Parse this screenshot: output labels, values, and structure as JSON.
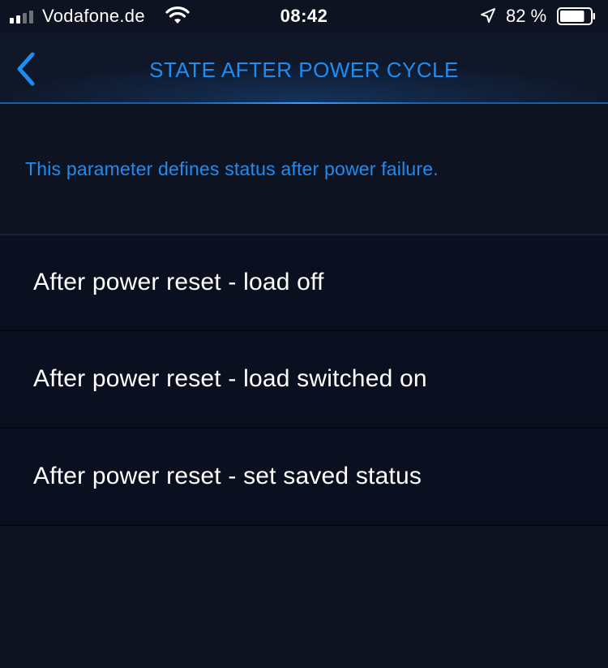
{
  "status_bar": {
    "carrier": "Vodafone.de",
    "time": "08:42",
    "battery_percent": "82 %",
    "battery_level": 0.82,
    "signal_bars_filled": 2,
    "signal_bars_total": 4
  },
  "nav": {
    "title": "STATE AFTER POWER CYCLE",
    "back_icon": "chevron-left-icon"
  },
  "description": "This parameter defines status after power failure.",
  "options": [
    {
      "label": "After power reset - load off"
    },
    {
      "label": "After power reset - load switched on"
    },
    {
      "label": "After power reset - set saved status"
    }
  ],
  "colors": {
    "accent": "#1e8cf0",
    "background": "#0e1322",
    "row_background": "#0b1020",
    "text": "#ffffff"
  }
}
